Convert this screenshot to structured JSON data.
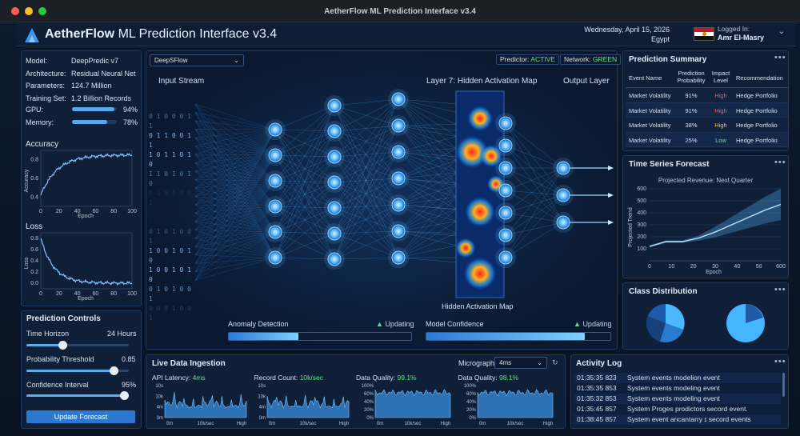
{
  "window": {
    "title": "AetherFlow ML Prediction Interface v3.4"
  },
  "header": {
    "brand": "AetherFlow",
    "subtitle": "ML Prediction Interface v3.4",
    "date": "Wednesday, April 15, 2026",
    "location": "Egypt",
    "login_label": "Logged In:",
    "user": "Amr El-Masry"
  },
  "model_info": {
    "rows": [
      {
        "label": "Model:",
        "value": "DeepPredic v7"
      },
      {
        "label": "Architecture:",
        "value": "Residual Neural Net"
      },
      {
        "label": "Parameters:",
        "value": "124.7 Million"
      },
      {
        "label": "Training Set:",
        "value": "1.2 Billion Records"
      }
    ],
    "gpu": {
      "label": "GPU:",
      "value": "94%",
      "fraction": 0.94
    },
    "memory": {
      "label": "Memory:",
      "value": "78%",
      "fraction": 0.78
    }
  },
  "accuracy_chart": {
    "title": "Accuracy",
    "ylabel": "Accuracy",
    "xlabel": "Epoch",
    "x_ticks": [
      "0",
      "20",
      "40",
      "60",
      "80",
      "100"
    ],
    "y_ticks": [
      "0.4",
      "0.6",
      "0.8"
    ]
  },
  "loss_chart": {
    "title": "Loss",
    "ylabel": "Loss",
    "xlabel": "Epoch",
    "x_ticks": [
      "0",
      "20",
      "40",
      "60",
      "80",
      "100"
    ],
    "y_ticks": [
      "0.0",
      "0.2",
      "0.4",
      "0.6",
      "0.8"
    ]
  },
  "controls": {
    "title": "Prediction Controls",
    "time_horizon": {
      "label": "Time Horizon",
      "value": "24 Hours",
      "fraction": 0.35
    },
    "probability": {
      "label": "Probability Threshold",
      "value": "0.85",
      "fraction": 0.85
    },
    "confidence": {
      "label": "Confidence Interval",
      "value": "95%",
      "fraction": 0.95
    },
    "button": "Update Forecast"
  },
  "network": {
    "dropdown": "DeepSFlow",
    "predictor_label": "Predictor:",
    "predictor_status": "ACTIVE",
    "network_label": "Network:",
    "network_status": "GREEN",
    "input_label": "Input Stream",
    "layer_label": "Layer 7: Hidden Activation Map",
    "output_label": "Output Layer",
    "activation_caption": "Hidden Activation Map",
    "binary": [
      "0 1 0 0 0 1 1",
      "0 1 1 0 0 1 1",
      "1 0 1 1 0 1 0",
      "1 1 0 1 0 1 0",
      "0 1 0 1 0 0 1",
      "0 1 0 1 0 0 1",
      "0 1 0 1 0 0 1",
      "1 0 0 1 0 1 0",
      "1 0 0 1 0 1 0",
      "0 1 0 1 0 0 1",
      "0 0 0 1 0 0 1",
      "0 0 1 0 1 0 1"
    ],
    "anomaly": {
      "label": "Anomaly Detection",
      "status": "Updating",
      "fraction": 0.38
    },
    "confidence": {
      "label": "Model Confidence",
      "status": "Updating",
      "fraction": 0.86
    }
  },
  "summary": {
    "title": "Prediction Summary",
    "headers": [
      "Event Name",
      "Prediction Probability",
      "Impact Level",
      "Recommendation"
    ],
    "rows": [
      {
        "event": "Market Volatility",
        "prob": "91%",
        "impact": "High",
        "rec": "Hedge Portfolio",
        "color": "#ff5a5a"
      },
      {
        "event": "Market Volatility",
        "prob": "91%",
        "impact": "High",
        "rec": "Hedge Portfolio",
        "color": "#ff5a5a"
      },
      {
        "event": "Market Volatility",
        "prob": "38%",
        "impact": "High",
        "rec": "Hedge Portfolio",
        "color": "#f5c542"
      },
      {
        "event": "Market Volatility",
        "prob": "25%",
        "impact": "Low",
        "rec": "Hedge Portfolio",
        "color": "#6fe08a"
      }
    ]
  },
  "forecast": {
    "title": "Time Series Forecast",
    "chart_title": "Projected Revenue: Next Quarter",
    "ylabel": "Projected Trend",
    "xlabel": "Epoch",
    "x_ticks": [
      "0",
      "10",
      "20",
      "30",
      "40",
      "50",
      "600"
    ],
    "y_ticks": [
      "100",
      "200",
      "300",
      "400",
      "500",
      "600"
    ]
  },
  "class_dist": {
    "title": "Class Distribution"
  },
  "ingestion": {
    "title": "Live Data Ingestion",
    "micrograph_label": "Micrograph",
    "micrograph_value": "4ms",
    "metrics": [
      {
        "label": "API Latency:",
        "value": "4ms",
        "y_ticks": [
          "10s",
          "10k",
          "4m",
          "0m"
        ]
      },
      {
        "label": "Record Count:",
        "value": "10k/sec",
        "y_ticks": [
          "10s",
          "10k",
          "4m",
          "0m"
        ]
      },
      {
        "label": "Data Quality:",
        "value": "99.1%",
        "y_ticks": [
          "100%",
          "60%",
          "40%",
          "20%",
          "0%"
        ]
      },
      {
        "label": "Data Quality:",
        "value": "98.1%",
        "y_ticks": [
          "100%",
          "60%",
          "40%",
          "20%",
          "0%"
        ]
      }
    ],
    "x_ticks": [
      "0m",
      "10k/sec",
      "High"
    ]
  },
  "activity": {
    "title": "Activity Log",
    "rows": [
      {
        "time": "01:35:35 823",
        "text": "System events modelion event"
      },
      {
        "time": "01:35:35 853",
        "text": "System events modeling event"
      },
      {
        "time": "01:35:32 853",
        "text": "System events modeling event"
      },
      {
        "time": "01:35:45 857",
        "text": "System Proges prodictors secord event."
      },
      {
        "time": "01:38:45 857",
        "text": "System event ancantarry ɪ secord events"
      }
    ]
  },
  "colors": {
    "accent": "#4fb3ff",
    "panel": "#0f1f38",
    "high": "#ff5a5a",
    "medium": "#f5c542",
    "low": "#6fe08a",
    "ok": "#5fe38c"
  }
}
